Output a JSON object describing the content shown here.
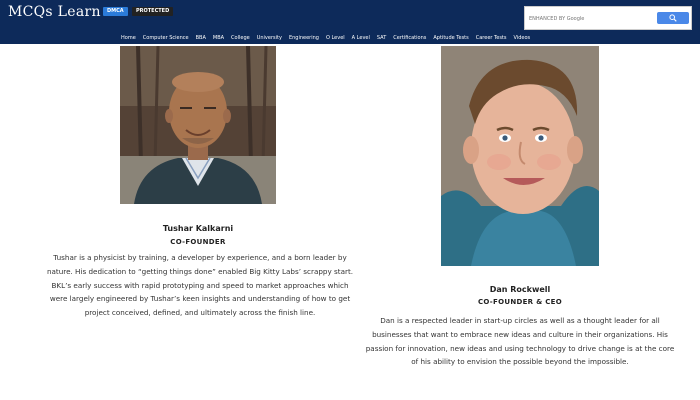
{
  "header": {
    "logo": "MCQs Learn",
    "badges": [
      "DMCA",
      "PROTECTED"
    ],
    "search": {
      "placeholder": "ENHANCED BY Google"
    },
    "nav": [
      "Home",
      "Computer Science",
      "BBA",
      "MBA",
      "College",
      "University",
      "Engineering",
      "O Level",
      "A Level",
      "SAT",
      "Certifications",
      "Aptitude Tests",
      "Career Tests",
      "Videos"
    ]
  },
  "team": [
    {
      "name": "Tushar Kalkarni",
      "role": "CO-FOUNDER",
      "bio": "Tushar is a physicist by training, a developer by experience, and a born leader by nature. His dedication to “getting things done” enabled Big Kitty Labs’ scrappy start. BKL’s early success with rapid prototyping and speed to market approaches which were largely engineered by Tushar’s keen insights and understanding of how to get project conceived, defined, and ultimately across the finish line."
    },
    {
      "name": "Dan Rockwell",
      "role": "CO-FOUNDER & CEO",
      "bio": "Dan is a respected leader in start-up circles as well as a thought leader for all businesses that want to embrace new ideas and culture in their organizations. His passion for innovation, new ideas and using technology to drive change is at the core of his ability to envision the possible beyond the impossible."
    }
  ],
  "colors": {
    "header_bg": "#0d2a5a",
    "search_button": "#4a88e8",
    "dmca_badge": "#2b7bd9"
  }
}
